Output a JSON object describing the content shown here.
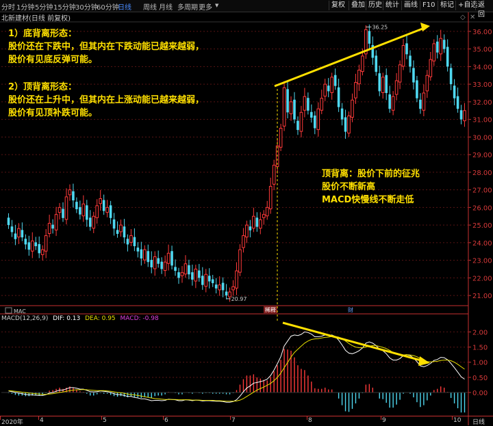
{
  "toolbar": {
    "periods": [
      "分时",
      "1分钟",
      "5分钟",
      "15分钟",
      "30分钟",
      "60分钟",
      "日线",
      "周线",
      "月线",
      "多周期",
      "更多"
    ],
    "active_period": "日线",
    "buttons": [
      "复权",
      "叠加",
      "历史",
      "统计",
      "画线",
      "F10",
      "标记",
      "+自选",
      "返回"
    ]
  },
  "stock_title": "北新建材(日线 前复权)",
  "annotations": {
    "bottom_divergence_title": "1）底背离形态：",
    "bottom_divergence_line1": "股价还在下跌中，但其内在下跌动能已越来越弱，",
    "bottom_divergence_line2": "股价有见底反弹可能。",
    "top_divergence_title": "2）顶背离形态：",
    "top_divergence_line1": "股价还在上升中，但其内在上涨动能已越来越弱，",
    "top_divergence_line2": "股价有见顶补跌可能。",
    "signal_line1": "顶背离：股价下前的征兆",
    "signal_line2": "股价不断新高",
    "signal_line3": "MACD快慢线不断走低"
  },
  "price_markers": {
    "high": "36.25",
    "low": "20.97"
  },
  "event_tags": {
    "tag1": "稀释",
    "tag2": "财"
  },
  "macd_panel": {
    "indicator_tab": "MAC",
    "title": "MACD(12,26,9)",
    "dif": "DIF: 0.13",
    "dea": "DEA: 0.95",
    "macd": "MACD: -0.98"
  },
  "price_axis": [
    "36.00",
    "35.00",
    "34.00",
    "33.00",
    "32.00",
    "31.00",
    "30.00",
    "29.00",
    "28.00",
    "27.00",
    "26.00",
    "25.00",
    "24.00",
    "23.00",
    "22.00",
    "21.00"
  ],
  "macd_axis": [
    "2.00",
    "1.50",
    "1.00",
    "0.50",
    "0.00"
  ],
  "x_axis": [
    "2020年",
    "4",
    "5",
    "6",
    "7",
    "8",
    "9",
    "10"
  ],
  "x_axis_right": "日线",
  "colors": {
    "up": "#ff3a3a",
    "down": "#4fd8f0",
    "annotation": "#ffe000",
    "dif": "#ffffff",
    "dea": "#e8e000",
    "axis": "#c83030"
  },
  "chart_data": {
    "type": "candlestick",
    "price_ylim": [
      20.5,
      36.5
    ],
    "high_marker": 36.25,
    "low_marker": 20.97,
    "closes": [
      25.0,
      24.6,
      24.2,
      24.8,
      24.3,
      23.9,
      23.6,
      24.1,
      23.8,
      23.4,
      23.6,
      24.4,
      25.1,
      24.8,
      25.6,
      26.0,
      25.4,
      26.6,
      27.0,
      26.4,
      25.9,
      25.6,
      26.2,
      25.3,
      24.9,
      25.5,
      26.1,
      26.5,
      25.8,
      26.0,
      25.4,
      24.8,
      24.5,
      25.0,
      24.3,
      23.9,
      24.4,
      23.8,
      23.5,
      23.1,
      23.6,
      22.9,
      22.6,
      23.2,
      22.8,
      22.5,
      22.9,
      23.4,
      22.7,
      22.4,
      22.0,
      22.3,
      22.8,
      22.2,
      21.9,
      22.5,
      22.0,
      21.6,
      22.2,
      21.8,
      21.7,
      21.4,
      21.6,
      21.3,
      21.0,
      21.2,
      21.5,
      22.4,
      23.6,
      24.4,
      25.0,
      24.7,
      25.5,
      24.9,
      25.3,
      25.6,
      26.0,
      27.2,
      28.4,
      29.5,
      30.5,
      32.8,
      31.4,
      32.0,
      31.0,
      30.4,
      31.4,
      32.3,
      31.5,
      31.1,
      30.5,
      31.6,
      32.2,
      33.0,
      32.6,
      33.4,
      32.9,
      31.7,
      31.0,
      30.3,
      31.2,
      32.1,
      33.1,
      33.8,
      34.6,
      36.1,
      35.3,
      34.5,
      33.7,
      32.6,
      33.4,
      32.5,
      31.6,
      32.3,
      33.2,
      34.1,
      35.2,
      34.7,
      34.0,
      33.1,
      32.2,
      31.6,
      32.5,
      33.5,
      34.4,
      35.3,
      34.8,
      35.6,
      35.0,
      34.0,
      33.0,
      32.2,
      31.6,
      31.0,
      31.5
    ],
    "macd_ylim": [
      -1.2,
      2.4
    ],
    "dif": [
      0.05,
      0.03,
      0.0,
      -0.02,
      -0.04,
      -0.06,
      -0.08,
      -0.08,
      -0.09,
      -0.1,
      -0.1,
      -0.07,
      -0.02,
      0.0,
      0.04,
      0.08,
      0.08,
      0.12,
      0.16,
      0.16,
      0.14,
      0.11,
      0.11,
      0.07,
      0.03,
      0.02,
      0.03,
      0.05,
      0.04,
      0.03,
      0.0,
      -0.04,
      -0.07,
      -0.07,
      -0.1,
      -0.13,
      -0.13,
      -0.16,
      -0.18,
      -0.21,
      -0.21,
      -0.24,
      -0.27,
      -0.26,
      -0.26,
      -0.27,
      -0.26,
      -0.22,
      -0.23,
      -0.24,
      -0.27,
      -0.27,
      -0.24,
      -0.25,
      -0.27,
      -0.25,
      -0.26,
      -0.28,
      -0.27,
      -0.27,
      -0.28,
      -0.29,
      -0.29,
      -0.3,
      -0.32,
      -0.32,
      -0.3,
      -0.24,
      -0.12,
      0.02,
      0.15,
      0.22,
      0.31,
      0.33,
      0.36,
      0.39,
      0.44,
      0.56,
      0.74,
      0.95,
      1.18,
      1.54,
      1.7,
      1.86,
      1.9,
      1.88,
      1.92,
      2.0,
      1.98,
      1.93,
      1.84,
      1.84,
      1.86,
      1.9,
      1.88,
      1.9,
      1.85,
      1.73,
      1.57,
      1.39,
      1.3,
      1.28,
      1.32,
      1.38,
      1.47,
      1.63,
      1.67,
      1.63,
      1.55,
      1.42,
      1.38,
      1.28,
      1.14,
      1.07,
      1.07,
      1.12,
      1.22,
      1.25,
      1.22,
      1.14,
      1.02,
      0.88,
      0.85,
      0.89,
      0.96,
      1.06,
      1.09,
      1.16,
      1.15,
      1.08,
      0.96,
      0.82,
      0.67,
      0.52,
      0.44
    ],
    "dea": [
      0.06,
      0.05,
      0.04,
      0.03,
      0.01,
      0.0,
      -0.02,
      -0.03,
      -0.04,
      -0.05,
      -0.06,
      -0.06,
      -0.05,
      -0.04,
      -0.02,
      0.0,
      0.02,
      0.04,
      0.06,
      0.08,
      0.09,
      0.09,
      0.1,
      0.09,
      0.08,
      0.07,
      0.06,
      0.06,
      0.06,
      0.05,
      0.04,
      0.02,
      0.0,
      -0.01,
      -0.03,
      -0.05,
      -0.07,
      -0.08,
      -0.1,
      -0.12,
      -0.14,
      -0.16,
      -0.18,
      -0.2,
      -0.21,
      -0.22,
      -0.23,
      -0.23,
      -0.23,
      -0.23,
      -0.24,
      -0.24,
      -0.24,
      -0.24,
      -0.25,
      -0.25,
      -0.25,
      -0.26,
      -0.26,
      -0.26,
      -0.26,
      -0.27,
      -0.27,
      -0.28,
      -0.29,
      -0.29,
      -0.29,
      -0.28,
      -0.25,
      -0.2,
      -0.13,
      -0.06,
      0.01,
      0.08,
      0.13,
      0.18,
      0.24,
      0.3,
      0.39,
      0.5,
      0.64,
      0.82,
      0.99,
      1.17,
      1.32,
      1.43,
      1.53,
      1.63,
      1.7,
      1.75,
      1.77,
      1.78,
      1.8,
      1.82,
      1.83,
      1.85,
      1.85,
      1.83,
      1.78,
      1.7,
      1.62,
      1.55,
      1.5,
      1.48,
      1.48,
      1.5,
      1.53,
      1.55,
      1.55,
      1.52,
      1.49,
      1.45,
      1.39,
      1.32,
      1.27,
      1.24,
      1.24,
      1.25,
      1.24,
      1.22,
      1.18,
      1.12,
      1.06,
      1.02,
      1.01,
      1.02,
      1.03,
      1.06,
      1.07,
      1.07,
      1.05,
      1.0,
      0.93,
      0.85,
      0.77
    ]
  }
}
